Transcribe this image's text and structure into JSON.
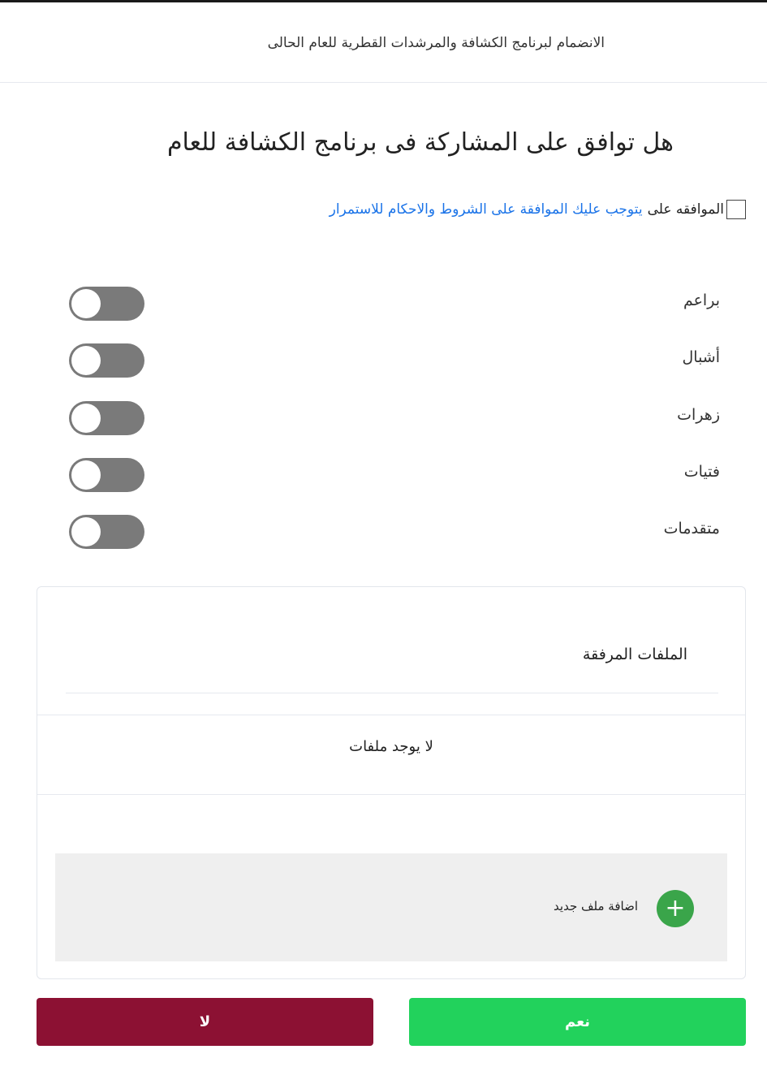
{
  "header": {
    "title": "الانضمام لبرنامج الكشافة والمرشدات القطرية للعام الحالى"
  },
  "question": "هل توافق على المشاركة فى برنامج الكشافة للعام",
  "agreement": {
    "checked": false,
    "label": "الموافقه على",
    "link_text": "يتوجب عليك الموافقة على الشروط والاحكام للاستمرار"
  },
  "toggles": [
    {
      "label": "براعم",
      "on": false
    },
    {
      "label": "أشبال",
      "on": false
    },
    {
      "label": "زهرات",
      "on": false
    },
    {
      "label": "فتيات",
      "on": false
    },
    {
      "label": "متقدمات",
      "on": false
    }
  ],
  "attachments": {
    "title": "الملفات المرفقة",
    "empty_text": "لا يوجد ملفات",
    "add_label": "اضافة ملف جديد",
    "add_icon": "plus-icon",
    "add_color": "#3aa54a"
  },
  "buttons": {
    "no_label": "لا",
    "yes_label": "نعم",
    "no_color": "#8c1133",
    "yes_color": "#22d25c"
  }
}
